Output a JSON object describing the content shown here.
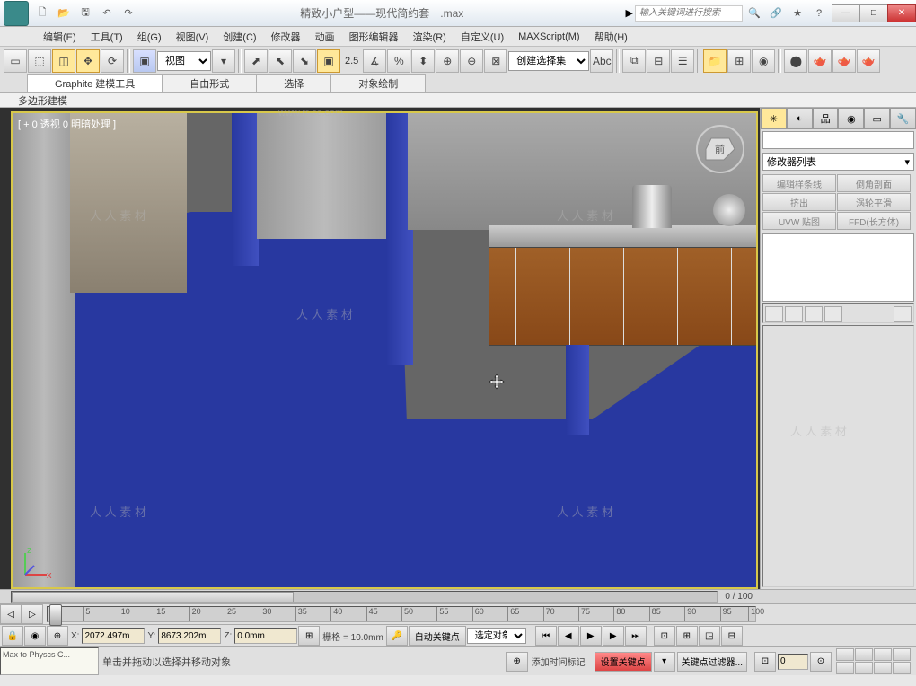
{
  "titlebar": {
    "title": "精致小户型——现代简约套一.max",
    "search_placeholder": "输入关键词进行搜索"
  },
  "menu": {
    "items": [
      "编辑(E)",
      "工具(T)",
      "组(G)",
      "视图(V)",
      "创建(C)",
      "修改器",
      "动画",
      "图形编辑器",
      "渲染(R)",
      "自定义(U)",
      "MAXScript(M)",
      "帮助(H)"
    ]
  },
  "maintoolbar": {
    "ref_combo": "视图",
    "spinner_val": "2.5",
    "sel_set": "创建选择集"
  },
  "ribbon": {
    "tabs": [
      "Graphite 建模工具",
      "自由形式",
      "选择",
      "对象绘制"
    ],
    "sub": "多边形建模"
  },
  "viewport": {
    "label": "[ + 0 透视  0 明暗处理 ]",
    "frame_indicator": "0 / 100"
  },
  "cmdpanel": {
    "mod_list_label": "修改器列表",
    "mod_buttons": [
      "编辑样条线",
      "倒角剖面",
      "挤出",
      "涡轮平滑",
      "UVW 贴图",
      "FFD(长方体)"
    ]
  },
  "timeline": {
    "ticks": [
      0,
      5,
      10,
      15,
      20,
      25,
      30,
      35,
      40,
      45,
      50,
      55,
      60,
      65,
      70,
      75,
      80,
      85,
      90,
      95,
      100
    ]
  },
  "status": {
    "x": "2072.497m",
    "y": "8673.202m",
    "z": "0.0mm",
    "grid": "栅格 = 10.0mm",
    "autokey": "自动关键点",
    "selected": "选定对象",
    "setkey": "设置关键点",
    "keyfilter": "关键点过滤器...",
    "frame_field": "0"
  },
  "prompt": {
    "script": "Max to Physcs C...",
    "line1": "单击并拖动以选择并移动对象",
    "line2": "添加时间标记"
  },
  "watermark": {
    "text": "人 人 素 材",
    "url": "www.rr-sc.com"
  }
}
